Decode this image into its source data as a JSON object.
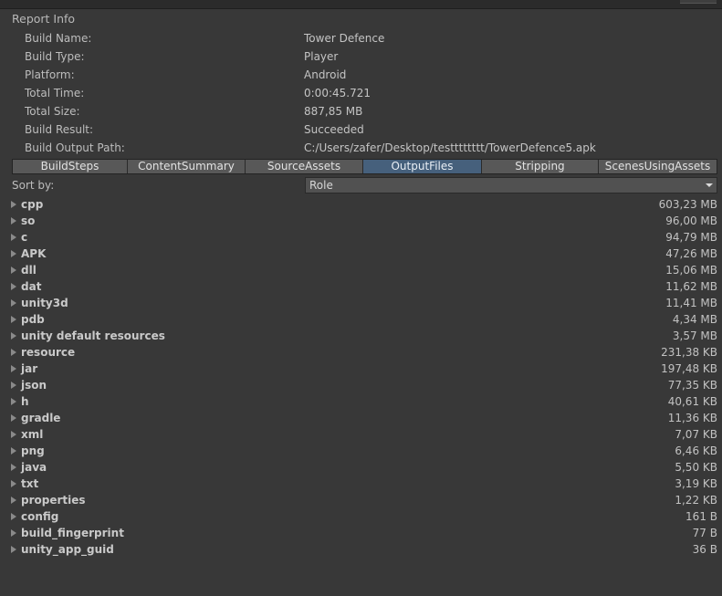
{
  "report": {
    "title": "Report Info",
    "fields": [
      {
        "label": "Build Name:",
        "value": "Tower Defence"
      },
      {
        "label": "Build Type:",
        "value": "Player"
      },
      {
        "label": "Platform:",
        "value": "Android"
      },
      {
        "label": "Total Time:",
        "value": "0:00:45.721"
      },
      {
        "label": "Total Size:",
        "value": "887,85 MB"
      },
      {
        "label": "Build Result:",
        "value": "Succeeded"
      },
      {
        "label": "Build Output Path:",
        "value": "C:/Users/zafer/Desktop/testttttttt/TowerDefence5.apk"
      }
    ]
  },
  "tabs": [
    {
      "label": "BuildSteps",
      "active": false
    },
    {
      "label": "ContentSummary",
      "active": false
    },
    {
      "label": "SourceAssets",
      "active": false
    },
    {
      "label": "OutputFiles",
      "active": true
    },
    {
      "label": "Stripping",
      "active": false
    },
    {
      "label": "ScenesUsingAssets",
      "active": false
    }
  ],
  "sort": {
    "label": "Sort by:",
    "selected": "Role"
  },
  "files": [
    {
      "name": "cpp",
      "size": "603,23 MB"
    },
    {
      "name": "so",
      "size": "96,00 MB"
    },
    {
      "name": "c",
      "size": "94,79 MB"
    },
    {
      "name": "APK",
      "size": "47,26 MB"
    },
    {
      "name": "dll",
      "size": "15,06 MB"
    },
    {
      "name": "dat",
      "size": "11,62 MB"
    },
    {
      "name": "unity3d",
      "size": "11,41 MB"
    },
    {
      "name": "pdb",
      "size": "4,34 MB"
    },
    {
      "name": "unity default resources",
      "size": "3,57 MB"
    },
    {
      "name": "resource",
      "size": "231,38 KB"
    },
    {
      "name": "jar",
      "size": "197,48 KB"
    },
    {
      "name": "json",
      "size": "77,35 KB"
    },
    {
      "name": "h",
      "size": "40,61 KB"
    },
    {
      "name": "gradle",
      "size": "11,36 KB"
    },
    {
      "name": "xml",
      "size": "7,07 KB"
    },
    {
      "name": "png",
      "size": "6,46 KB"
    },
    {
      "name": "java",
      "size": "5,50 KB"
    },
    {
      "name": "txt",
      "size": "3,19 KB"
    },
    {
      "name": "properties",
      "size": "1,22 KB"
    },
    {
      "name": "config",
      "size": "161 B"
    },
    {
      "name": "build_fingerprint",
      "size": "77 B"
    },
    {
      "name": "unity_app_guid",
      "size": "36 B"
    }
  ],
  "colors": {
    "background": "#383838",
    "active_tab": "#46607c",
    "tab": "#585858"
  }
}
